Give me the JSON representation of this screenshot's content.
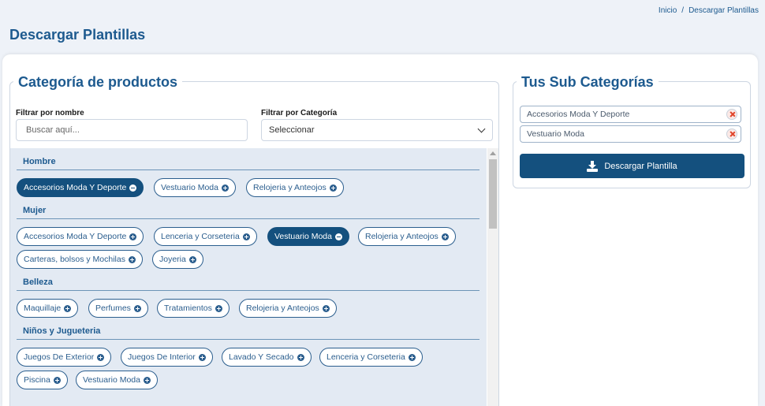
{
  "breadcrumb": {
    "home": "Inicio",
    "separator": "/",
    "current": "Descargar Plantillas"
  },
  "page_title": "Descargar Plantillas",
  "categories_panel": {
    "title": "Categoría de productos",
    "filter_name_label": "Filtrar por nombre",
    "filter_name_placeholder": "Buscar aquí...",
    "filter_category_label": "Filtrar por Categoría",
    "filter_category_value": "Seleccionar",
    "groups": [
      {
        "name": "Hombre",
        "chips": [
          {
            "label": "Accesorios Moda Y Deporte",
            "selected": true
          },
          {
            "label": "Vestuario Moda",
            "selected": false
          },
          {
            "label": "Relojeria y Anteojos",
            "selected": false
          }
        ]
      },
      {
        "name": "Mujer",
        "chips": [
          {
            "label": "Accesorios Moda Y Deporte",
            "selected": false
          },
          {
            "label": "Lenceria y Corseteria",
            "selected": false
          },
          {
            "label": "Vestuario Moda",
            "selected": true
          },
          {
            "label": "Relojeria y Anteojos",
            "selected": false
          },
          {
            "label": "Carteras, bolsos y Mochilas",
            "selected": false
          },
          {
            "label": "Joyeria",
            "selected": false
          }
        ]
      },
      {
        "name": "Belleza",
        "chips": [
          {
            "label": "Maquillaje",
            "selected": false
          },
          {
            "label": "Perfumes",
            "selected": false
          },
          {
            "label": "Tratamientos",
            "selected": false
          },
          {
            "label": "Relojeria y Anteojos",
            "selected": false
          }
        ]
      },
      {
        "name": "Niños y Jugueteria",
        "chips": [
          {
            "label": "Juegos De Exterior",
            "selected": false
          },
          {
            "label": "Juegos De Interior",
            "selected": false
          },
          {
            "label": "Lavado Y Secado",
            "selected": false
          },
          {
            "label": "Lenceria y Corseteria",
            "selected": false
          },
          {
            "label": "Piscina",
            "selected": false
          },
          {
            "label": "Vestuario Moda",
            "selected": false
          }
        ]
      }
    ]
  },
  "subcategories_panel": {
    "title": "Tus Sub Categorías",
    "items": [
      "Accesorios Moda Y Deporte",
      "Vestuario Moda"
    ],
    "download_label": "Descargar Plantilla"
  },
  "colors": {
    "primary": "#14507e",
    "accent_text": "#1d5a8f",
    "list_bg": "#e3eaf3",
    "remove": "#e0442a"
  }
}
